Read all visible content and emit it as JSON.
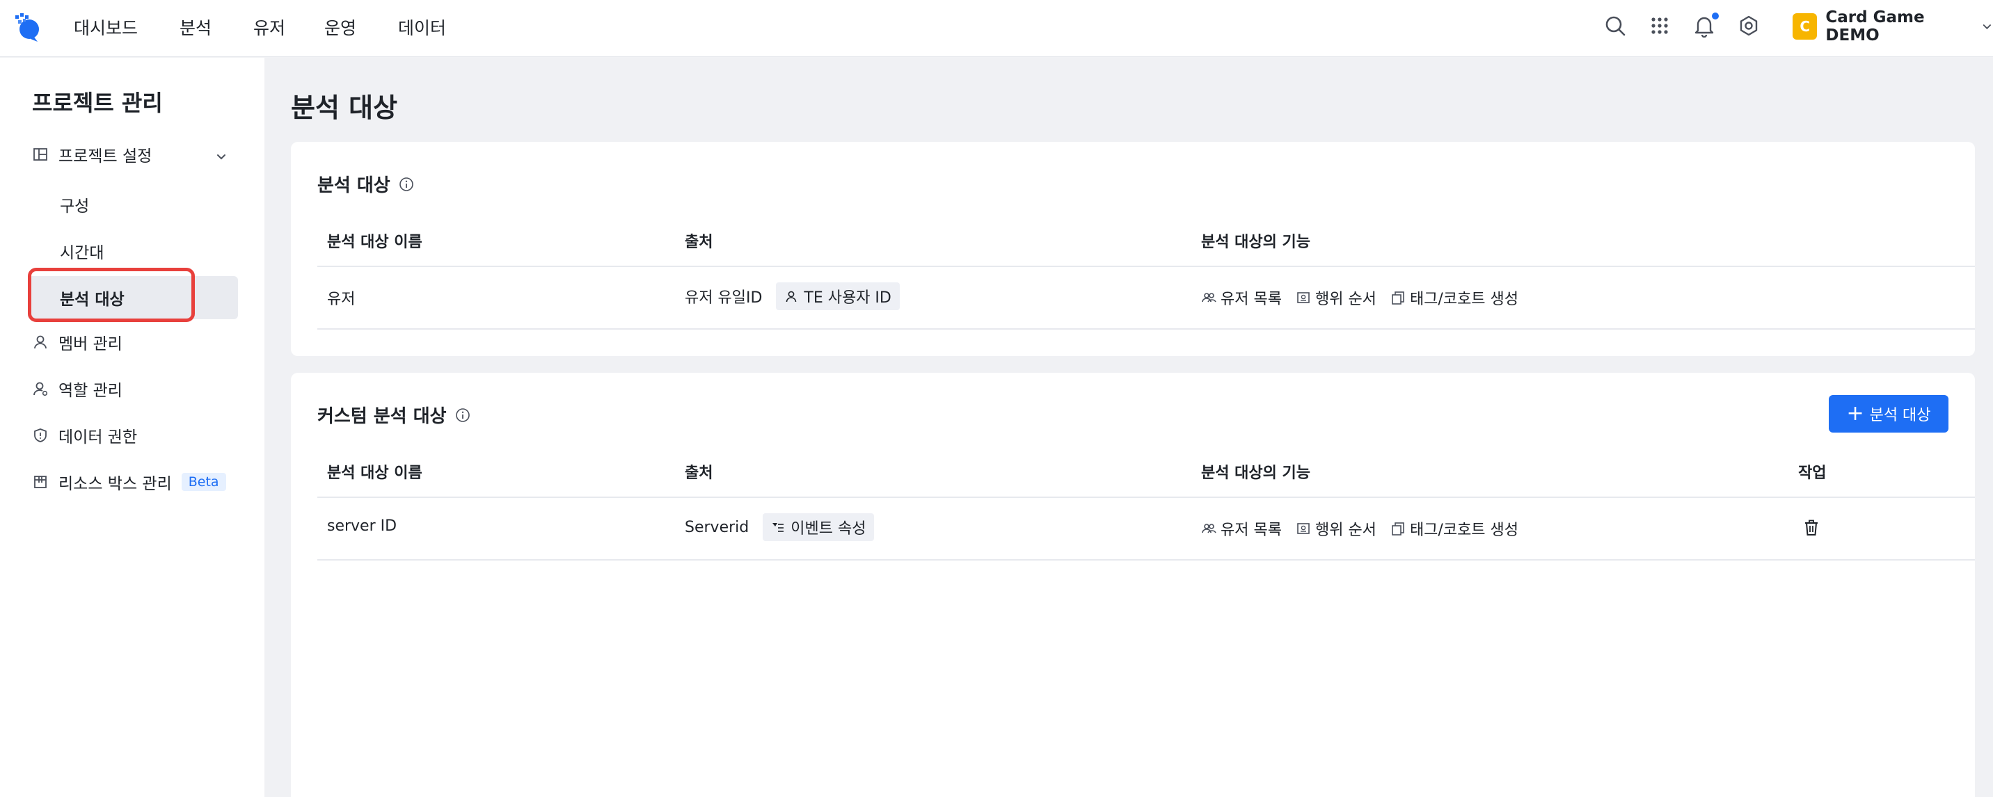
{
  "nav": {
    "items": [
      "대시보드",
      "분석",
      "유저",
      "운영",
      "데이터"
    ],
    "project": {
      "avatar_letter": "C",
      "name": "Card Game DEMO"
    }
  },
  "sidebar": {
    "title": "프로젝트 관리",
    "project_settings": "프로젝트 설정",
    "sub_items": [
      "구성",
      "시간대",
      "분석 대상"
    ],
    "member": "멤버 관리",
    "role": "역할 관리",
    "data_permission": "데이터 권한",
    "resource_box": "리소스 박스 관리",
    "beta": "Beta"
  },
  "main": {
    "page_title": "분석 대상",
    "card1": {
      "title": "분석 대상",
      "headers": [
        "분석 대상 이름",
        "출처",
        "분석 대상의 기능"
      ],
      "row": {
        "name": "유저",
        "source": "유저 유일ID",
        "source_tag": "TE 사용자 ID",
        "features": [
          "유저 목록",
          "행위 순서",
          "태그/코호트 생성"
        ]
      }
    },
    "card2": {
      "title": "커스텀 분석 대상",
      "add_button": "분석 대상",
      "headers": [
        "분석 대상 이름",
        "출처",
        "분석 대상의 기능",
        "작업"
      ],
      "row": {
        "name": "server ID",
        "source": "Serverid",
        "source_tag": "이벤트 속성",
        "features": [
          "유저 목록",
          "행위 순서",
          "태그/코호트 생성"
        ]
      }
    }
  },
  "colors": {
    "primary": "#1e6ef4",
    "highlight": "#e8403c",
    "avatar": "#f7b500"
  }
}
